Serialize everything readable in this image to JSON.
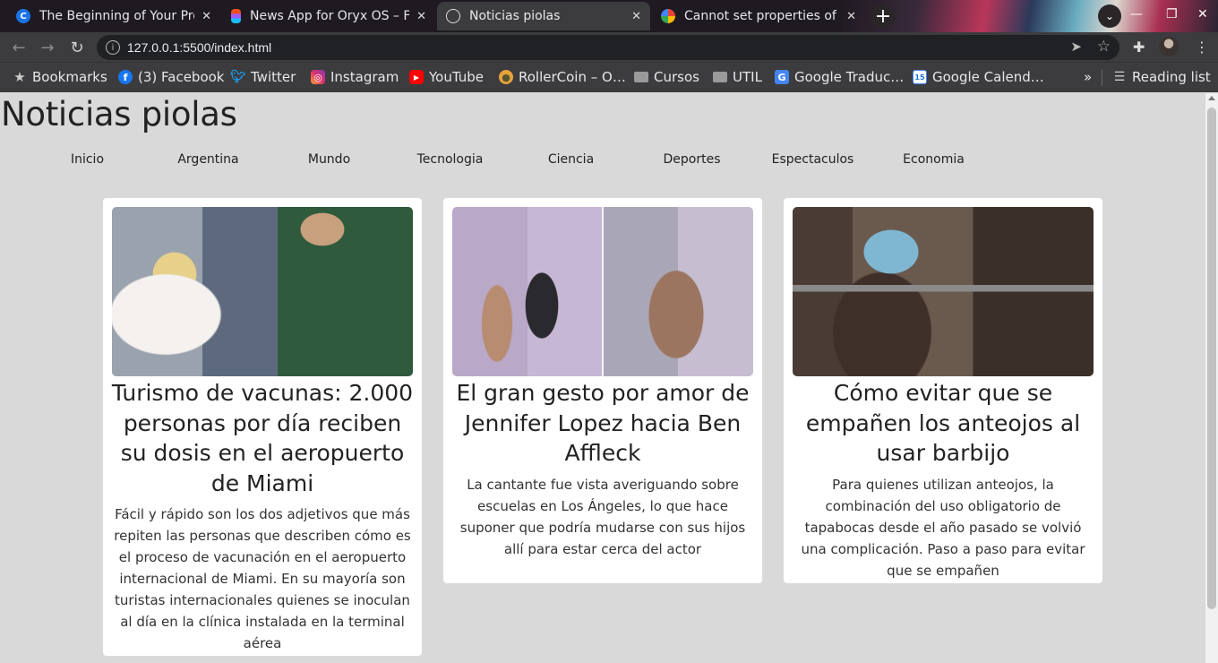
{
  "browser": {
    "tabs": [
      {
        "title": "The Beginning of Your Pro",
        "favicon": "C",
        "favicon_color": "#1a73e8",
        "active": false
      },
      {
        "title": "News App for Oryx OS – Fi",
        "favicon": "figma",
        "favicon_color": "#f24e1e",
        "active": false
      },
      {
        "title": "Noticias piolas",
        "favicon": "globe",
        "favicon_color": "#bbbbbb",
        "active": true
      },
      {
        "title": "Cannot set properties of r",
        "favicon": "G",
        "favicon_color": "#4285f4",
        "active": false
      }
    ],
    "new_tab_label": "+",
    "url": "127.0.0.1:5500/index.html",
    "bookmarks_bar": [
      {
        "label": "Bookmarks",
        "icon": "star-icon"
      },
      {
        "label": "(3) Facebook",
        "icon": "facebook-icon"
      },
      {
        "label": "Twitter",
        "icon": "twitter-icon"
      },
      {
        "label": "Instagram",
        "icon": "instagram-icon"
      },
      {
        "label": "YouTube",
        "icon": "youtube-icon"
      },
      {
        "label": "RollerCoin – O…",
        "icon": "rollercoin-icon"
      },
      {
        "label": "Cursos",
        "icon": "folder-icon"
      },
      {
        "label": "UTIL",
        "icon": "folder-icon"
      },
      {
        "label": "Google Traduc…",
        "icon": "google-translate-icon"
      },
      {
        "label": "Google Calend…",
        "icon": "google-calendar-icon"
      }
    ],
    "overflow_label": "»",
    "reading_list_label": "Reading list"
  },
  "site": {
    "title": "Noticias piolas",
    "nav": [
      "Inicio",
      "Argentina",
      "Mundo",
      "Tecnologia",
      "Ciencia",
      "Deportes",
      "Espectaculos",
      "Economia"
    ]
  },
  "articles": [
    {
      "title": "Turismo de vacunas: 2.000 personas por día reciben su dosis en el aeropuerto de Miami",
      "summary": "Fácil y rápido son los dos adjetivos que más repiten las personas que describen cómo es el proceso de vacunación en el aeropuerto internacional de Miami. En su mayoría son turistas internacionales quienes se inoculan al día en la clínica instalada en la terminal aérea"
    },
    {
      "title": "El gran gesto por amor de Jennifer Lopez hacia Ben Affleck",
      "summary": "La cantante fue vista averiguando sobre escuelas en Los Ángeles, lo que hace suponer que podría mudarse con sus hijos allí para estar cerca del actor"
    },
    {
      "title": "Cómo evitar que se empañen los anteojos al usar barbijo",
      "summary": "Para quienes utilizan anteojos, la combinación del uso obligatorio de tapabocas desde el año pasado se volvió una complicación. Paso a paso para evitar que se empañen"
    }
  ]
}
